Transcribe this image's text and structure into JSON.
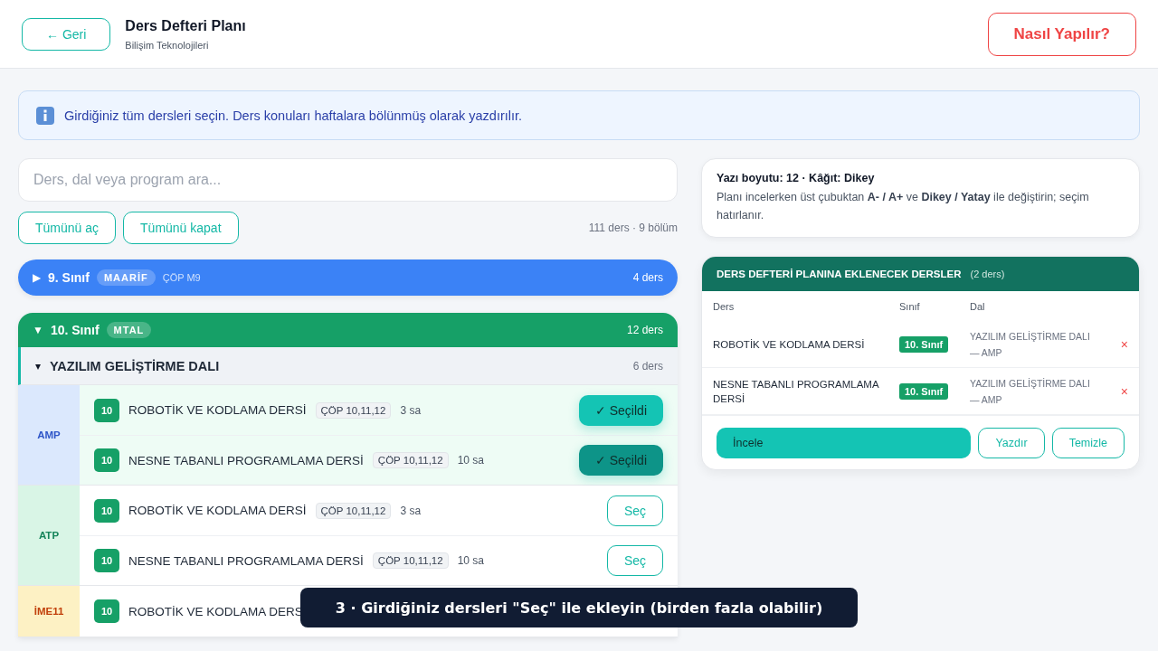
{
  "header": {
    "back_button": "← Geri",
    "title": "Ders Defteri Planı",
    "subtitle": "Bilişim Teknolojileri",
    "help_button": "Nasıl Yapılır?"
  },
  "info": {
    "text": "Girdiğiniz tüm dersleri seçin. Ders konuları haftalara bölünmüş olarak yazdırılır."
  },
  "search": {
    "placeholder": "Ders, dal veya program ara..."
  },
  "list_actions": {
    "expand_all": "Tümünü aç",
    "collapse_all": "Tümünü kapat",
    "summary": "111 ders · 9 bölüm"
  },
  "grades": [
    {
      "caret": "▶",
      "label": "9. Sınıf",
      "tag": "MAARİF",
      "program": "ÇÖP M9",
      "count": "4 ders",
      "expanded": false,
      "color": "#3b82f6"
    },
    {
      "caret": "▼",
      "label": "10. Sınıf",
      "tag": "MTAL",
      "count": "12 ders",
      "expanded": true,
      "color": "#16a067",
      "branches": [
        {
          "caret": "▾",
          "name": "YAZILIM GELİŞTİRME DALI",
          "count": "6 ders",
          "expanded": true,
          "groups": [
            {
              "label": "AMP",
              "kind": "amp",
              "rows": [
                {
                  "grade": "10",
                  "name": "ROBOTİK VE KODLAMA DERSİ",
                  "program": "ÇÖP 10,11,12",
                  "hours": "3 sa",
                  "selected": true,
                  "hovered": false,
                  "button": "✓ Seçildi"
                },
                {
                  "grade": "10",
                  "name": "NESNE TABANLI PROGRAMLAMA DERSİ",
                  "program": "ÇÖP 10,11,12",
                  "hours": "10 sa",
                  "selected": true,
                  "hovered": true,
                  "button": "✓ Seçildi"
                }
              ]
            },
            {
              "label": "ATP",
              "kind": "atp",
              "rows": [
                {
                  "grade": "10",
                  "name": "ROBOTİK VE KODLAMA DERSİ",
                  "program": "ÇÖP 10,11,12",
                  "hours": "3 sa",
                  "selected": false,
                  "hovered": false,
                  "button": "Seç"
                },
                {
                  "grade": "10",
                  "name": "NESNE TABANLI PROGRAMLAMA DERSİ",
                  "program": "ÇÖP 10,11,12",
                  "hours": "10 sa",
                  "selected": false,
                  "hovered": false,
                  "button": "Seç"
                }
              ]
            },
            {
              "label": "İME11",
              "kind": "ime",
              "rows": [
                {
                  "grade": "10",
                  "name": "ROBOTİK VE KODLAMA DERS"
                }
              ]
            }
          ]
        }
      ]
    }
  ],
  "settings": {
    "title": "Yazı boyutu: 12 · Kâğıt: Dikey",
    "text": "Planı incelerken üst çubuktan **A- / A+** ve **Dikey / Yatay** ile değiştirin; seçim hatırlanır."
  },
  "plan": {
    "title": "DERS DEFTERİ PLANINA EKLENECEK DERSLER",
    "count": "(2 ders)",
    "columns": [
      "Ders",
      "Sınıf",
      "Dal"
    ],
    "rows": [
      {
        "course": "ROBOTİK VE KODLAMA DERSİ",
        "grade": "10. Sınıf",
        "branch": "YAZILIM GELİŞTİRME DALI — AMP",
        "remove": "×"
      },
      {
        "course": "NESNE TABANLI PROGRAMLAMA DERSİ",
        "grade": "10. Sınıf",
        "branch": "YAZILIM GELİŞTİRME DALI — AMP",
        "remove": "×"
      }
    ],
    "review_button": "İncele",
    "print_button": "Yazdır",
    "clear_button": "Temizle"
  },
  "toast": "3 · Girdiğiniz dersleri \"Seç\" ile ekleyin (birden fazla olabilir)"
}
